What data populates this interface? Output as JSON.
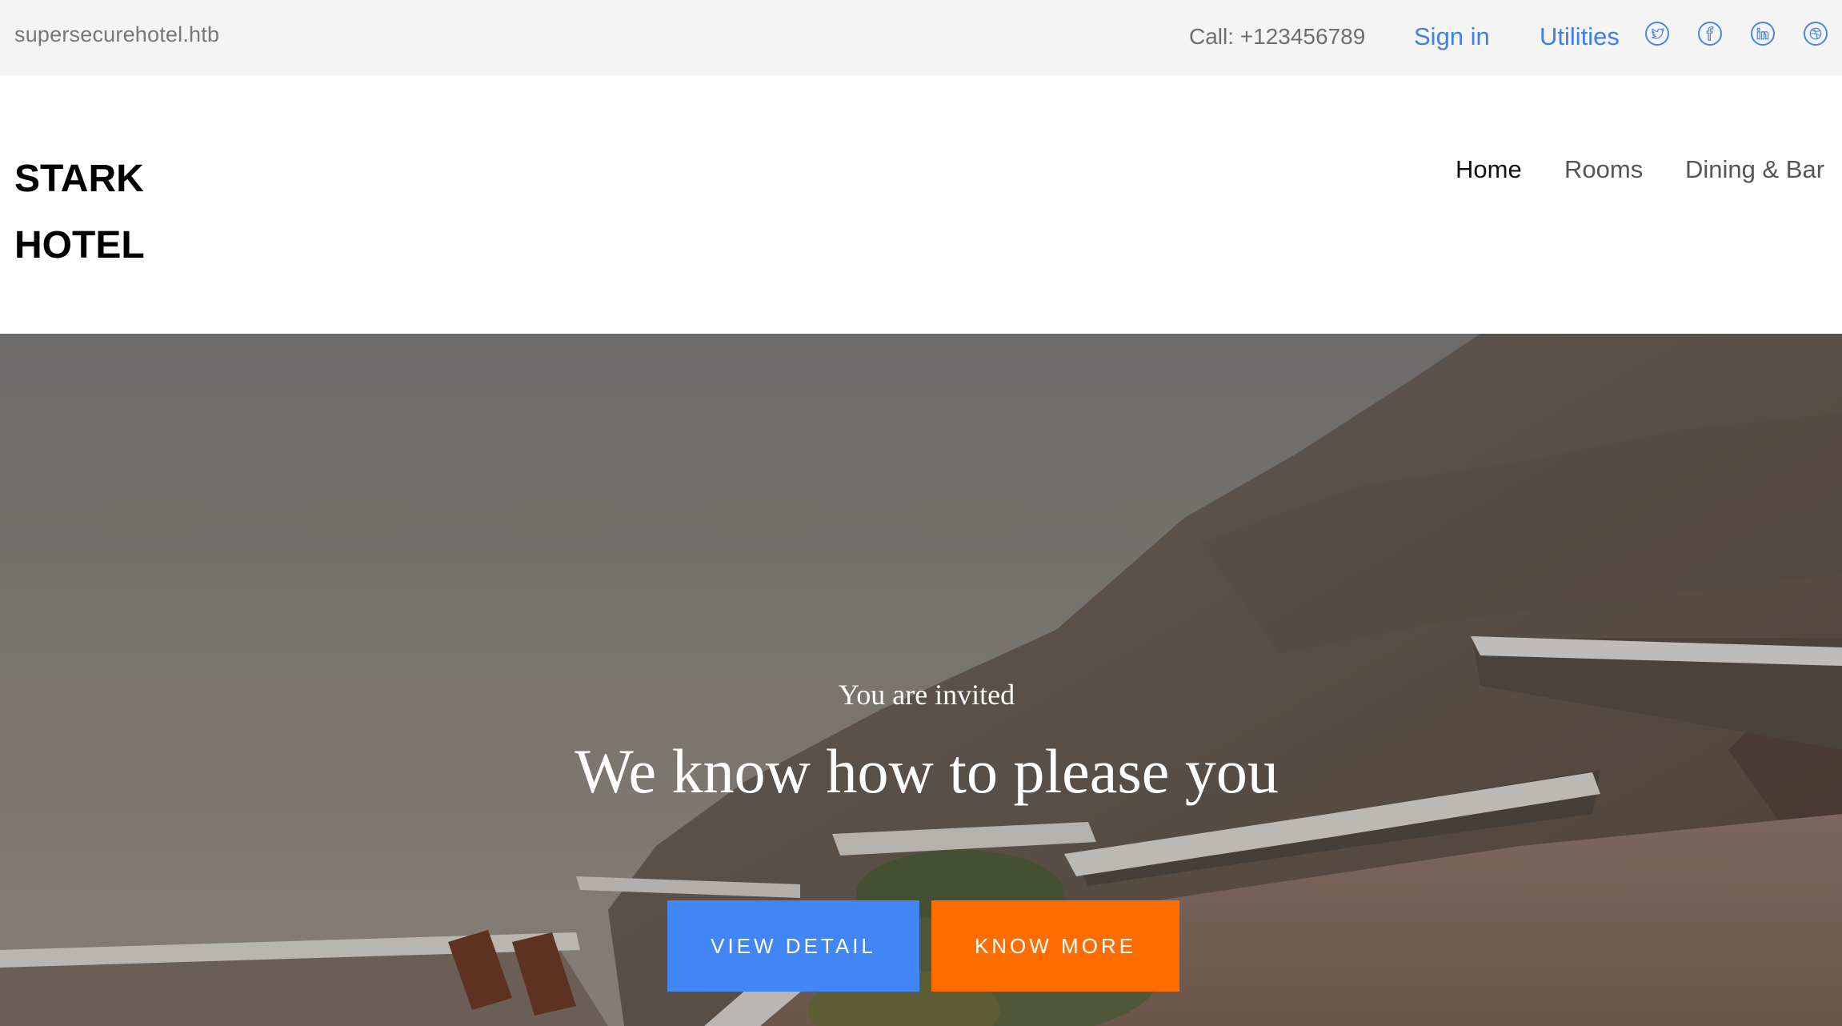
{
  "topbar": {
    "domain": "supersecurehotel.htb",
    "call": "Call: +123456789",
    "signin": "Sign in",
    "utilities": "Utilities",
    "social_icons": [
      "twitter-icon",
      "facebook-icon",
      "linkedin-icon",
      "dribbble-icon"
    ]
  },
  "header": {
    "brand_line1": "STARK",
    "brand_line2": "HOTEL",
    "nav": {
      "home": "Home",
      "rooms": "Rooms",
      "dining": "Dining & Bar"
    }
  },
  "hero": {
    "subtitle": "You are invited",
    "title": "We know how to please you",
    "button_detail": "VIEW DETAIL",
    "button_more": "KNOW MORE"
  },
  "colors": {
    "link_blue": "#3f7fe8",
    "button_blue": "#4285f4",
    "button_orange": "#ff6d00",
    "topbar_bg": "#f4f4f4"
  }
}
